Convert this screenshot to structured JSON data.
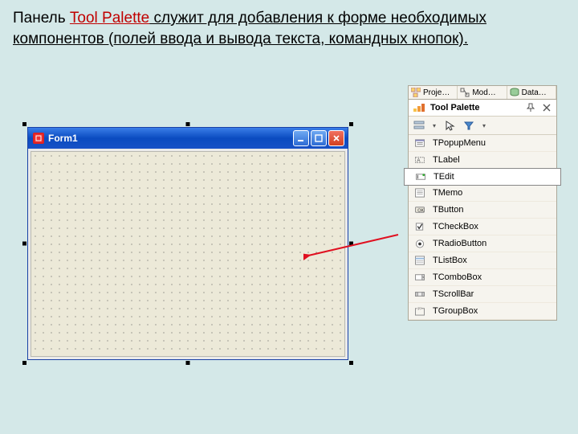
{
  "caption": {
    "pre": "Панель ",
    "highlight": "Tool",
    "highlight2": " Palette",
    "post": " служит для добавления  к форме необходимых компонентов (полей ввода и вывода текста, командных кнопок)."
  },
  "form": {
    "title": "Form1"
  },
  "tabs": [
    {
      "label": "Proje…"
    },
    {
      "label": "Mod…"
    },
    {
      "label": "Data…"
    }
  ],
  "palette": {
    "title": "Tool Palette",
    "items": [
      {
        "name": "TPopupMenu",
        "icon": "popup"
      },
      {
        "name": "TLabel",
        "icon": "label"
      },
      {
        "name": "TEdit",
        "icon": "edit",
        "selected": true
      },
      {
        "name": "TMemo",
        "icon": "memo"
      },
      {
        "name": "TButton",
        "icon": "button"
      },
      {
        "name": "TCheckBox",
        "icon": "checkbox"
      },
      {
        "name": "TRadioButton",
        "icon": "radio"
      },
      {
        "name": "TListBox",
        "icon": "listbox"
      },
      {
        "name": "TComboBox",
        "icon": "combo"
      },
      {
        "name": "TScrollBar",
        "icon": "scroll"
      },
      {
        "name": "TGroupBox",
        "icon": "group"
      }
    ]
  }
}
